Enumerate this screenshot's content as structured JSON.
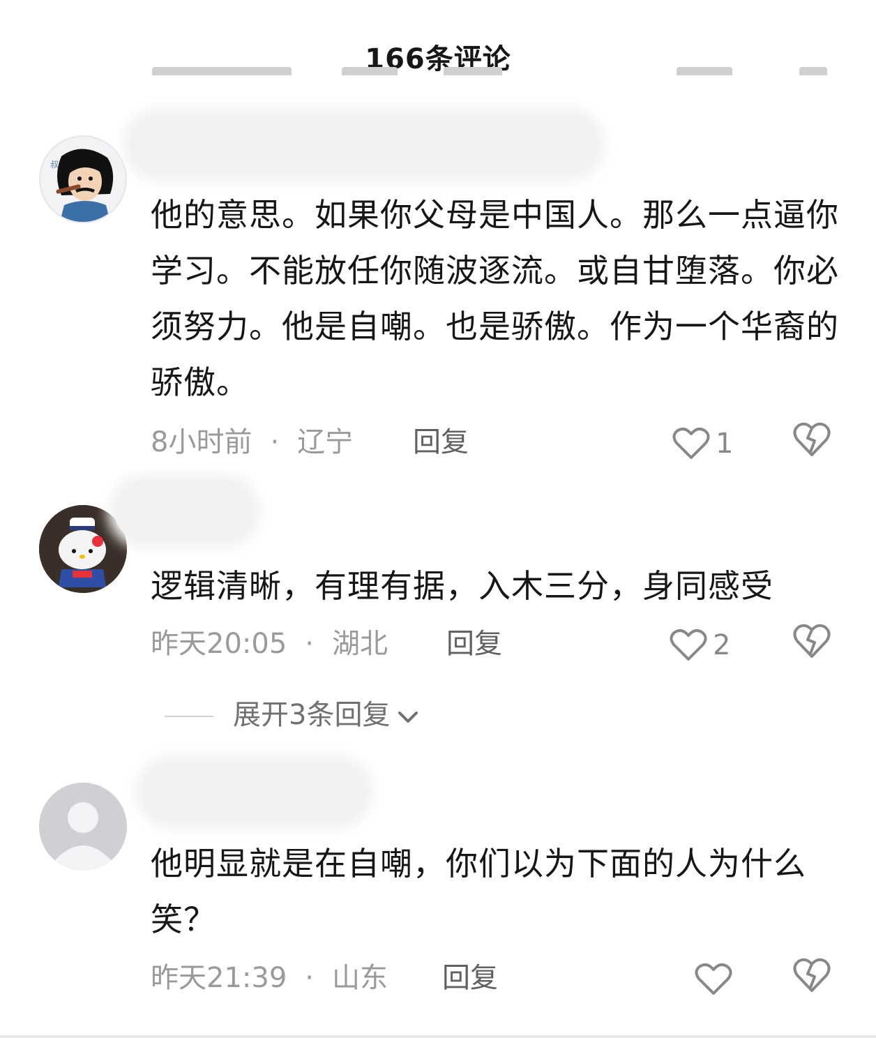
{
  "header": {
    "title": "166条评论"
  },
  "comments": [
    {
      "text": "他的意思。如果你父母是中国人。那么一点逼你学习。不能放任你随波逐流。或自甘堕落。你必须努力。他是自嘲。也是骄傲。作为一个华裔的骄傲。",
      "time": "8小时前",
      "dot": "·",
      "region": "辽宁",
      "reply": "回复",
      "likes": "1"
    },
    {
      "text": "逻辑清晰，有理有据，入木三分，身同感受",
      "time": "昨天20:05",
      "dot": "·",
      "region": "湖北",
      "reply": "回复",
      "likes": "2",
      "expand": "展开3条回复"
    },
    {
      "text": "他明显就是在自嘲，你们以为下面的人为什么笑？",
      "time": "昨天21:39",
      "dot": "·",
      "region": "山东",
      "reply": "回复",
      "likes": ""
    }
  ],
  "icons": {
    "like": "heart-outline-icon",
    "dislike": "broken-heart-icon",
    "expand": "chevron-down-icon"
  },
  "colors": {
    "text": "#161616",
    "meta": "#9a9a9a",
    "reply": "#606060",
    "icon": "#888888"
  }
}
